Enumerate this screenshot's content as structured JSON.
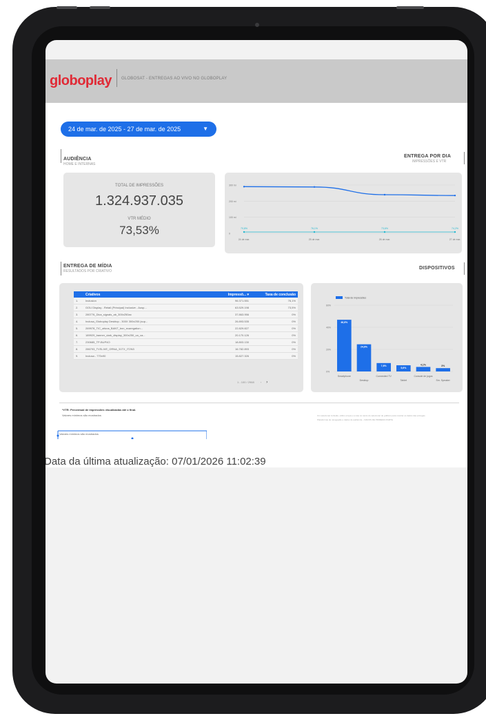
{
  "report": {
    "brand": "globoplay",
    "title": "GLOBOSAT - ENTREGAS AO VIVO NO GLOBOPLAY",
    "date_range": "24 de mar. de 2025 - 27 de mar. de 2025",
    "last_update": "Data da última atualização: 07/01/2026 11:02:39"
  },
  "audiencia": {
    "title": "AUDIÊNCIA",
    "subtitle": "HOME E INTERNAS",
    "impressions_label": "TOTAL DE IMPRESSÕES",
    "impressions_value": "1.324.937.035",
    "vtr_label": "VTR MÉDIO",
    "vtr_value": "73,53%"
  },
  "entrega_dia": {
    "title": "ENTREGA POR DIA",
    "subtitle": "IMPRESSÕES E VTR"
  },
  "entrega_midia": {
    "title": "ENTREGA DE MÍDIA",
    "subtitle": "RESULTADOS POR CRIATIVO",
    "columns": [
      "Criativos",
      "Impressõ... ▾",
      "Taxa de conclusão"
    ],
    "rows": [
      {
        "n": "1.",
        "name": "Inclusion",
        "impr": "96.371.551",
        "rate": "76,1%"
      },
      {
        "n": "2.",
        "name": "GOU Display - Retail (Principal) Inclusive - Ausp...",
        "impr": "63.529.198",
        "rate": "73,5%"
      },
      {
        "n": "3.",
        "name": "280776_Dica_signals_ab_300x250ax",
        "impr": "37.863.956",
        "rate": "0%"
      },
      {
        "n": "4.",
        "name": "Inclusa_Globoplay Desktop - 300X 300x250 (sup...",
        "impr": "26.893.535",
        "rate": "0%"
      },
      {
        "n": "5.",
        "name": "269978_TIC_ativos_BANT_bnn_ecaregation...",
        "impr": "22.829.827",
        "rate": "0%"
      },
      {
        "n": "6.",
        "name": "189929_banner_dark_display_300x250_ca_ca...",
        "impr": "20.170.126",
        "rate": "0%"
      },
      {
        "n": "7.",
        "name": "230685_TP-BUP4O",
        "impr": "18.803.130",
        "rate": "0%"
      },
      {
        "n": "8.",
        "name": "286793_TVSLIVE_ORNA_31TX_IT2N3",
        "impr": "16.782.893",
        "rate": "0%"
      },
      {
        "n": "9.",
        "name": "Inclusa - 770x90",
        "impr": "15.827.326",
        "rate": "0%"
      }
    ],
    "pager": "1 - 100 / 2968",
    "pager_prev": "‹",
    "pager_next": "›"
  },
  "dispositivos": {
    "title": "DISPOSITIVOS"
  },
  "footer": {
    "note_bold": "*VTR: Percentual de impressões visualizadas até o final.",
    "note_2": "Valores mínimos são mostrados",
    "note_3": "Valores mínimos são mostrados",
    "right_note_1": "Um selecionar inclusão, utilize a lupa e a nota no canto do selecionar de gráficos para mostrar os dados das entregas",
    "right_note_2": "Plataformas de navegação e dados de audiência – DADOS DE PRIMEIRA PARTE"
  },
  "chart_data": [
    {
      "type": "line",
      "x": [
        "24 de mar.",
        "25 de mar.",
        "26 de mar.",
        "27 de mar."
      ],
      "series": [
        {
          "values": [
            290,
            288,
            240,
            235
          ],
          "color": "#1e6fe8"
        },
        {
          "values": [
            70.8,
            76.1,
            73.6,
            74.2
          ],
          "color": "#22b8cf",
          "data_labels": [
            "70,8%",
            "76,1%",
            "73,6%",
            "74,2%"
          ]
        }
      ],
      "yticks": [
        "300 mi",
        "200 mi",
        "100 mi",
        "0"
      ],
      "ylim": [
        0,
        300
      ]
    },
    {
      "type": "bar",
      "categories": [
        "Smartphone",
        "Desktop",
        "Connected TV",
        "Tablet",
        "Consoles de Jogos",
        "Outros"
      ],
      "xtick_labels": [
        "Smartphone",
        "Desktop",
        "Connected TV",
        "Tablet",
        "Console de jogos",
        "Sm. Speaker"
      ],
      "values": [
        46.8,
        24.6,
        7.6,
        5.6,
        4.1,
        3.0
      ],
      "data_labels": [
        "46,8%",
        "24,6%",
        "7,6%",
        "5,6%",
        "4,1%",
        "3%"
      ],
      "series_name": "Total de impressões",
      "yticks": [
        "60%",
        "40%",
        "20%",
        "0%"
      ],
      "ylim": [
        0,
        60
      ],
      "color": "#1e6fe8"
    }
  ]
}
